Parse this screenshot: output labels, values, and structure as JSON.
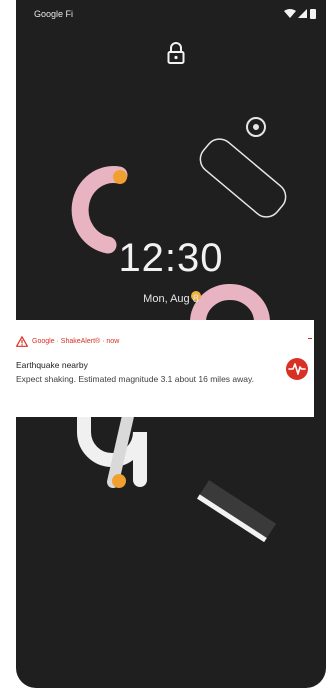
{
  "status_bar": {
    "carrier": "Google Fi",
    "icons": [
      "wifi-icon",
      "signal-icon",
      "battery-icon"
    ]
  },
  "lock_icon": "lock-icon",
  "clock": {
    "time": "12:30",
    "date": "Mon, Aug 8"
  },
  "notification": {
    "header": "Google · ShakeAlert® · now",
    "title": "Earthquake nearby",
    "body": "Expect shaking. Estimated magnitude 3.1 about 16 miles away.",
    "header_icon": "warning-icon",
    "app_icon": "earthquake-icon"
  },
  "colors": {
    "background": "#1f1f1f",
    "alert_red": "#d93025",
    "pink": "#e8b4c2",
    "orange": "#f0a030",
    "notification_bg": "#ffffff"
  }
}
